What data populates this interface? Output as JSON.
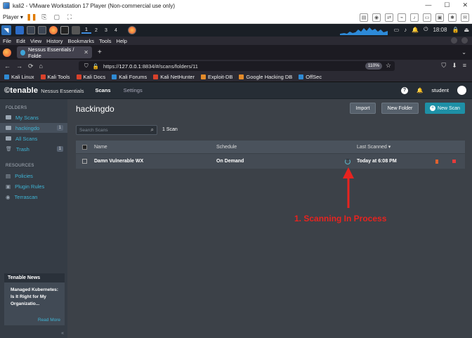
{
  "vm": {
    "title": "kali2 - VMware Workstation 17 Player (Non-commercial use only)",
    "player_label": "Player ▾"
  },
  "taskbar": {
    "workspaces": [
      "1",
      "2",
      "3",
      "4"
    ],
    "clock": "18:08"
  },
  "firefox": {
    "menu": [
      "File",
      "Edit",
      "View",
      "History",
      "Bookmarks",
      "Tools",
      "Help"
    ],
    "tab_title": "Nessus Essentials / Folde",
    "url_prefix": "https://",
    "url_host": "127.0.0.1",
    "url_rest": ":8834/#/scans/folders/11",
    "zoom": "110%",
    "bookmarks": [
      "Kali Linux",
      "Kali Tools",
      "Kali Docs",
      "Kali Forums",
      "Kali NetHunter",
      "Exploit-DB",
      "Google Hacking DB",
      "OffSec"
    ]
  },
  "nessus": {
    "brand": "©tenable",
    "product": "Nessus Essentials",
    "nav": [
      "Scans",
      "Settings"
    ],
    "user": "student",
    "sidebar": {
      "folders_heading": "FOLDERS",
      "folders": [
        {
          "label": "My Scans"
        },
        {
          "label": "hackingdo",
          "count": "1"
        },
        {
          "label": "All Scans"
        },
        {
          "label": "Trash",
          "count": "1"
        }
      ],
      "resources_heading": "RESOURCES",
      "resources": [
        "Policies",
        "Plugin Rules",
        "Terrascan"
      ],
      "news": {
        "title": "Tenable News",
        "body": "Managed Kubernetes: Is It Right for My Organizatio...",
        "more": "Read More"
      }
    },
    "main": {
      "title": "hackingdo",
      "buttons": {
        "import": "Import",
        "new_folder": "New Folder",
        "new_scan": "New Scan"
      },
      "search_placeholder": "Search Scans",
      "scan_count": "1 Scan",
      "columns": {
        "name": "Name",
        "schedule": "Schedule",
        "last": "Last Scanned ▾"
      },
      "rows": [
        {
          "name": "Damn Vulnerable WX",
          "schedule": "On Demand",
          "last": "Today at 6:08 PM"
        }
      ]
    }
  },
  "annotation": {
    "text": "1. Scanning In Process",
    "color": "#e8231f"
  }
}
